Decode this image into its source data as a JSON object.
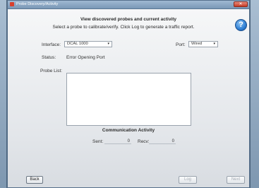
{
  "window": {
    "title": "Probe Discovery/Activity"
  },
  "header": {
    "line1": "View discovered probes and current activity",
    "line2": "Select a probe to calibrate/verify.  Click Log to generate a traffic report.",
    "help_label": "?"
  },
  "interface": {
    "label": "Interface:",
    "value": "DCAL 1000"
  },
  "port": {
    "label": "Port:",
    "value": "Wired"
  },
  "status": {
    "label": "Status:",
    "value": "Error Opening Port"
  },
  "probe_list": {
    "label": "Probe List:"
  },
  "communication": {
    "title": "Communication Activity",
    "sent_label": "Sent:",
    "sent_value": "0",
    "recv_label": "Recv:",
    "recv_value": "0"
  },
  "buttons": {
    "back": "Back",
    "log": "Log",
    "next": "Next"
  },
  "colors": {
    "help_button": "#2f7fd4",
    "close_button": "#c63b27"
  }
}
